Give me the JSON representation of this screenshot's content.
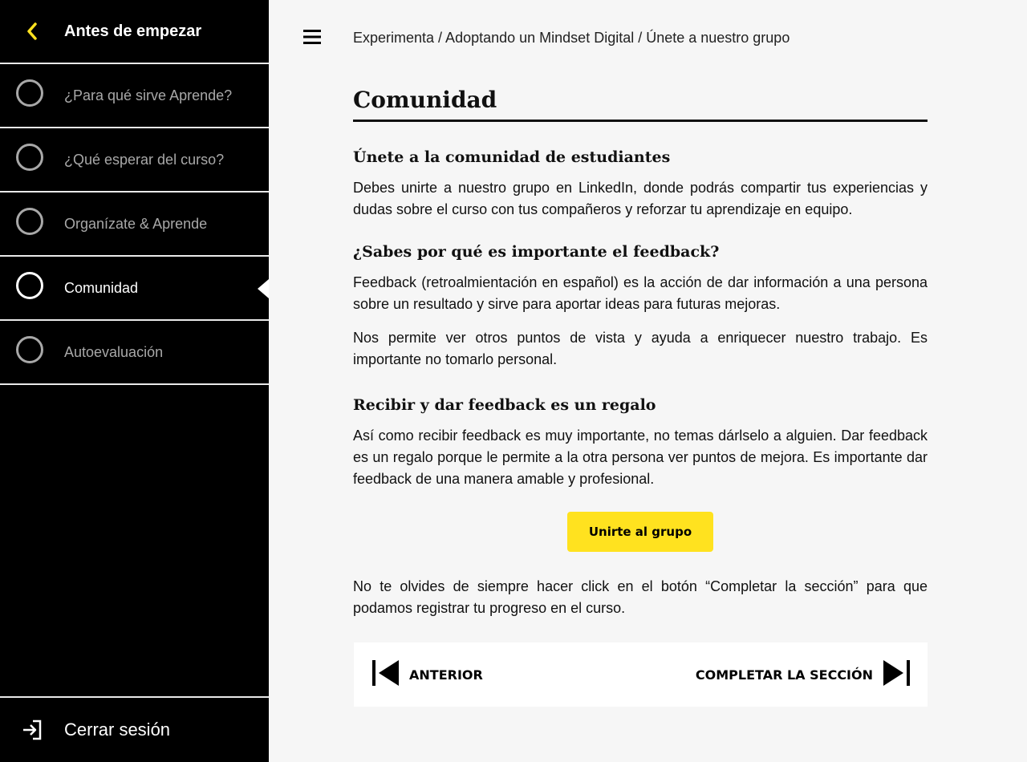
{
  "sidebar": {
    "title": "Antes de empezar",
    "items": [
      {
        "label": "¿Para qué sirve Aprende?",
        "active": false
      },
      {
        "label": "¿Qué esperar del curso?",
        "active": false
      },
      {
        "label": "Organízate & Aprende",
        "active": false
      },
      {
        "label": "Comunidad",
        "active": true
      },
      {
        "label": "Autoevaluación",
        "active": false
      }
    ],
    "logout_label": "Cerrar sesión"
  },
  "header": {
    "breadcrumb": "Experimenta / Adoptando un Mindset Digital / Únete a nuestro grupo"
  },
  "main": {
    "title": "Comunidad",
    "sections": [
      {
        "heading": "Únete a la comunidad de estudiantes",
        "paragraphs": [
          "Debes unirte a nuestro grupo en LinkedIn, donde podrás compartir tus experiencias y dudas sobre el curso con tus compañeros y reforzar tu aprendizaje en equipo."
        ]
      },
      {
        "heading": "¿Sabes por qué es importante el feedback?",
        "paragraphs": [
          "Feedback (retroalmientación en español) es la acción de dar información a una persona sobre un resultado y sirve para aportar ideas para futuras mejoras.",
          "Nos permite ver otros puntos de vista y ayuda a enriquecer nuestro trabajo. Es importante no tomarlo personal."
        ]
      },
      {
        "heading": "Recibir y dar feedback es un regalo",
        "paragraphs": [
          "Así como recibir feedback es muy importante, no temas dárlselo a alguien. Dar feedback es un regalo porque le permite a la otra persona ver puntos de mejora. Es importante dar feedback de una manera amable y profesional."
        ]
      }
    ],
    "cta_label": "Unirte al grupo",
    "reminder": "No te olvides de siempre hacer click en el botón “Completar la sección” para que podamos registrar tu progreso en el curso."
  },
  "nav": {
    "prev_label": "ANTERIOR",
    "next_label": "COMPLETAR LA SECCIÓN"
  },
  "colors": {
    "accent": "#ffe21f",
    "sidebar_bg": "#000000",
    "page_bg": "#f6f6f6"
  },
  "icons": [
    "chevron-left-icon",
    "menu-icon",
    "logout-icon",
    "skip-previous-icon",
    "skip-next-icon"
  ]
}
